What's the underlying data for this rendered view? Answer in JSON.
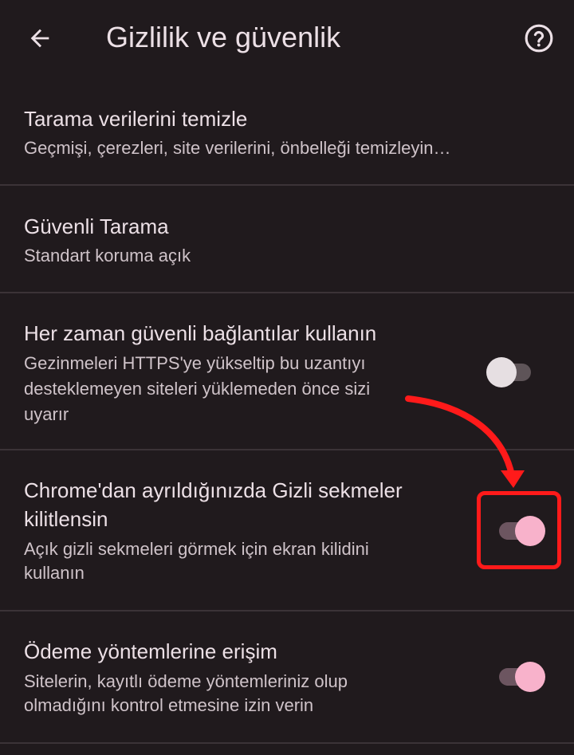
{
  "appbar": {
    "title": "Gizlilik ve güvenlik",
    "back_icon": "arrow-left-icon",
    "help_icon": "help-circle-icon"
  },
  "settings": [
    {
      "title": "Tarama verilerini temizle",
      "subtitle": "Geçmişi, çerezleri, site verilerini, önbelleği temizleyin…"
    },
    {
      "title": "Güvenli Tarama",
      "subtitle": "Standart koruma açık"
    },
    {
      "title": "Her zaman güvenli bağlantılar kullanın",
      "subtitle_lines": [
        "Gezinmeleri HTTPS'ye yükseltip bu uzantıyı",
        "desteklemeyen siteleri yüklemeden önce sizi",
        "uyarır"
      ],
      "toggle": false
    },
    {
      "title_lines": [
        "Chrome'dan ayrıldığınızda Gizli sekmeler",
        "kilitlensin"
      ],
      "subtitle_lines": [
        "Açık gizli sekmeleri görmek için ekran kilidini",
        "kullanın"
      ],
      "toggle": true
    },
    {
      "title": "Ödeme yöntemlerine erişim",
      "subtitle_lines": [
        "Sitelerin, kayıtlı ödeme yöntemleriniz olup",
        "olmadığını kontrol etmesine izin verin"
      ],
      "toggle": true
    }
  ],
  "colors": {
    "background": "#201a1d",
    "text_primary": "#ece0e6",
    "text_secondary": "#cfc3c9",
    "toggle_on_thumb": "#f8b2cb",
    "annotation": "#ff1a1a"
  }
}
